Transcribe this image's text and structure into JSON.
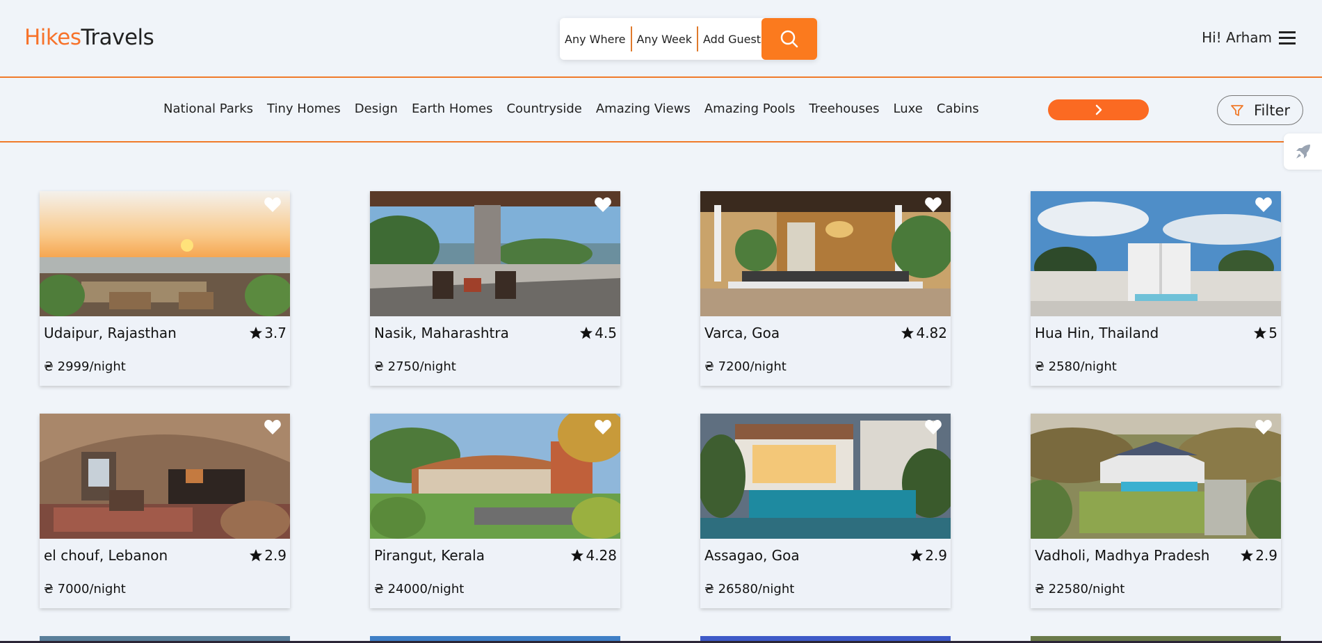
{
  "header": {
    "logo_brand": "Hikes",
    "logo_rest": "Travels",
    "search": {
      "where": "Any Where",
      "week": "Any Week",
      "guests": "Add Guests"
    },
    "greeting": "Hi! Arham"
  },
  "categories": [
    "National Parks",
    "Tiny Homes",
    "Design",
    "Earth Homes",
    "Countryside",
    "Amazing Views",
    "Amazing Pools",
    "Treehouses",
    "Luxe",
    "Cabins"
  ],
  "filter_label": "Filter",
  "colors": {
    "accent": "#fb7a1e",
    "background": "#f0f4f9"
  },
  "listings": [
    {
      "location": "Udaipur, Rajasthan",
      "rating": "3.7",
      "price": "₴ 2999/night"
    },
    {
      "location": "Nasik, Maharashtra",
      "rating": "4.5",
      "price": "₴ 2750/night"
    },
    {
      "location": "Varca, Goa",
      "rating": "4.82",
      "price": "₴ 7200/night"
    },
    {
      "location": "Hua Hin, Thailand",
      "rating": "5",
      "price": "₴ 2580/night"
    },
    {
      "location": "el chouf, Lebanon",
      "rating": "2.9",
      "price": "₴ 7000/night"
    },
    {
      "location": "Pirangut, Kerala",
      "rating": "4.28",
      "price": "₴ 24000/night"
    },
    {
      "location": "Assagao, Goa",
      "rating": "2.9",
      "price": "₴ 26580/night"
    },
    {
      "location": "Vadholi, Madhya Pradesh",
      "rating": "2.9",
      "price": "₴ 22580/night"
    }
  ]
}
